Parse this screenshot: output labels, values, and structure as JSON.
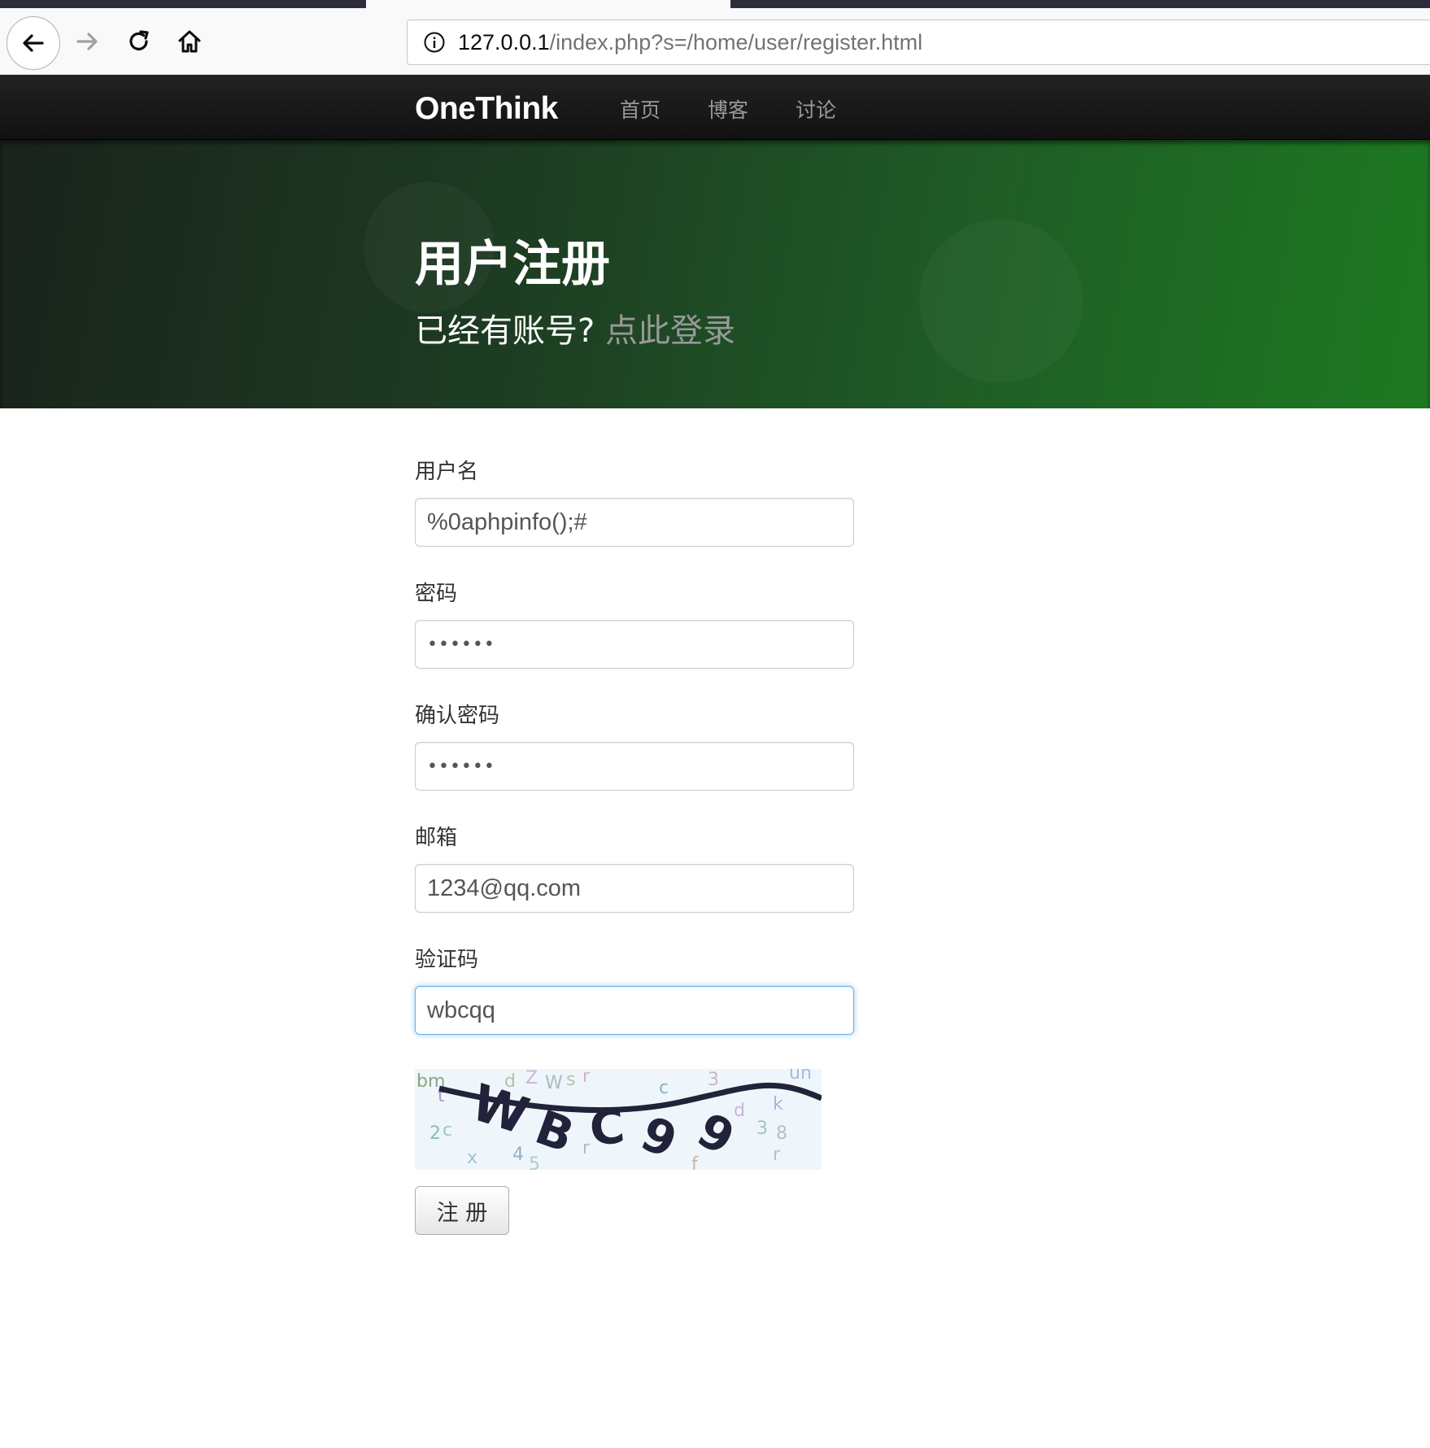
{
  "browser": {
    "url_host": "127.0.0.1",
    "url_path": "/index.php?s=/home/user/register.html",
    "icons": {
      "back": "arrow-left-icon",
      "forward": "arrow-right-icon",
      "reload": "reload-icon",
      "home": "home-icon",
      "info": "info-icon"
    }
  },
  "navbar": {
    "brand": "OneThink",
    "links": [
      "首页",
      "博客",
      "讨论"
    ]
  },
  "hero": {
    "title": "用户注册",
    "subtitle": "已经有账号?",
    "login_link": "点此登录"
  },
  "form": {
    "username": {
      "label": "用户名",
      "value": "%0aphpinfo();#"
    },
    "password": {
      "label": "密码",
      "value": "••••••"
    },
    "confirm_password": {
      "label": "确认密码",
      "value": "••••••"
    },
    "email": {
      "label": "邮箱",
      "value": "1234@qq.com"
    },
    "captcha": {
      "label": "验证码",
      "value": "wbcqq",
      "image_text": "WBC99"
    },
    "submit_label": "注 册"
  },
  "colors": {
    "navbar_bg": "#111111",
    "hero_green": "#1d7a21",
    "link_gray": "#999999",
    "focus_blue": "#66afe9"
  }
}
